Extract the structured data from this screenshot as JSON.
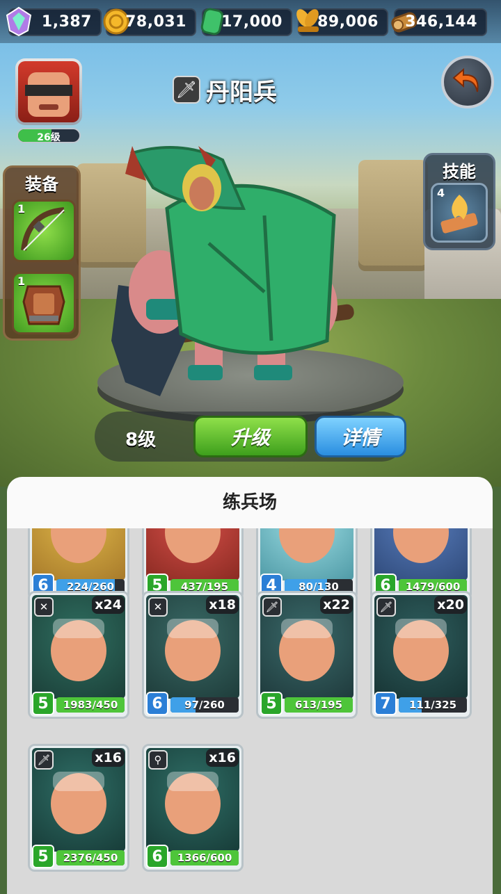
{
  "resources": [
    {
      "icon": "gem-icon",
      "value": "1,387"
    },
    {
      "icon": "coin-icon",
      "value": "78,031"
    },
    {
      "icon": "jade-icon",
      "value": "17,000"
    },
    {
      "icon": "grain-icon",
      "value": "89,006"
    },
    {
      "icon": "wood-icon",
      "value": "346,144"
    }
  ],
  "hero": {
    "level_label": "26级",
    "level_progress": 0.55
  },
  "unit": {
    "name": "丹阳兵",
    "type_icon": "sword-icon"
  },
  "equipment": {
    "title": "装备",
    "slots": [
      {
        "icon": "bow-icon",
        "count": "1"
      },
      {
        "icon": "armor-icon",
        "count": "1"
      }
    ]
  },
  "skill": {
    "title": "技能",
    "count": "4",
    "icon": "skill-flame-icon"
  },
  "actions": {
    "level": "8级",
    "upgrade": "升级",
    "details": "详情"
  },
  "panel": {
    "title": "练兵场"
  },
  "cards": [
    {
      "level": "6",
      "progress": "224/260",
      "ratio": 0.86,
      "color": "blue",
      "count": "",
      "type": "",
      "art": [
        "#e0b84a",
        "#a77a2a"
      ]
    },
    {
      "level": "5",
      "progress": "437/195",
      "ratio": 1.0,
      "color": "green",
      "count": "",
      "type": "",
      "art": [
        "#d9514a",
        "#8a2a22"
      ]
    },
    {
      "level": "4",
      "progress": "80/130",
      "ratio": 0.62,
      "color": "blue",
      "count": "",
      "type": "",
      "art": [
        "#9fe0e6",
        "#4f9aa6"
      ]
    },
    {
      "level": "6",
      "progress": "1479/600",
      "ratio": 1.0,
      "color": "green",
      "count": "",
      "type": "",
      "art": [
        "#5a7fbf",
        "#2f4a7a"
      ]
    },
    {
      "level": "5",
      "progress": "1983/450",
      "ratio": 1.0,
      "color": "green",
      "count": "x24",
      "type": "crossbow-icon",
      "art": [
        "#2f6e60",
        "#1b3f38"
      ]
    },
    {
      "level": "6",
      "progress": "97/260",
      "ratio": 0.37,
      "color": "blue",
      "count": "x18",
      "type": "crossbow-icon",
      "art": [
        "#3a6a66",
        "#1e3c3a"
      ]
    },
    {
      "level": "5",
      "progress": "613/195",
      "ratio": 1.0,
      "color": "green",
      "count": "x22",
      "type": "sword-icon",
      "art": [
        "#3a6a6a",
        "#1f3a3c"
      ]
    },
    {
      "level": "7",
      "progress": "111/325",
      "ratio": 0.34,
      "color": "blue",
      "count": "x20",
      "type": "sword-icon",
      "art": [
        "#2f5e5e",
        "#173434"
      ]
    },
    {
      "level": "5",
      "progress": "2376/450",
      "ratio": 1.0,
      "color": "green",
      "count": "x16",
      "type": "sword-icon",
      "art": [
        "#2f6e66",
        "#173c38"
      ]
    },
    {
      "level": "6",
      "progress": "1366/600",
      "ratio": 1.0,
      "color": "green",
      "count": "x16",
      "type": "staff-icon",
      "art": [
        "#2f6e66",
        "#173c38"
      ]
    }
  ]
}
